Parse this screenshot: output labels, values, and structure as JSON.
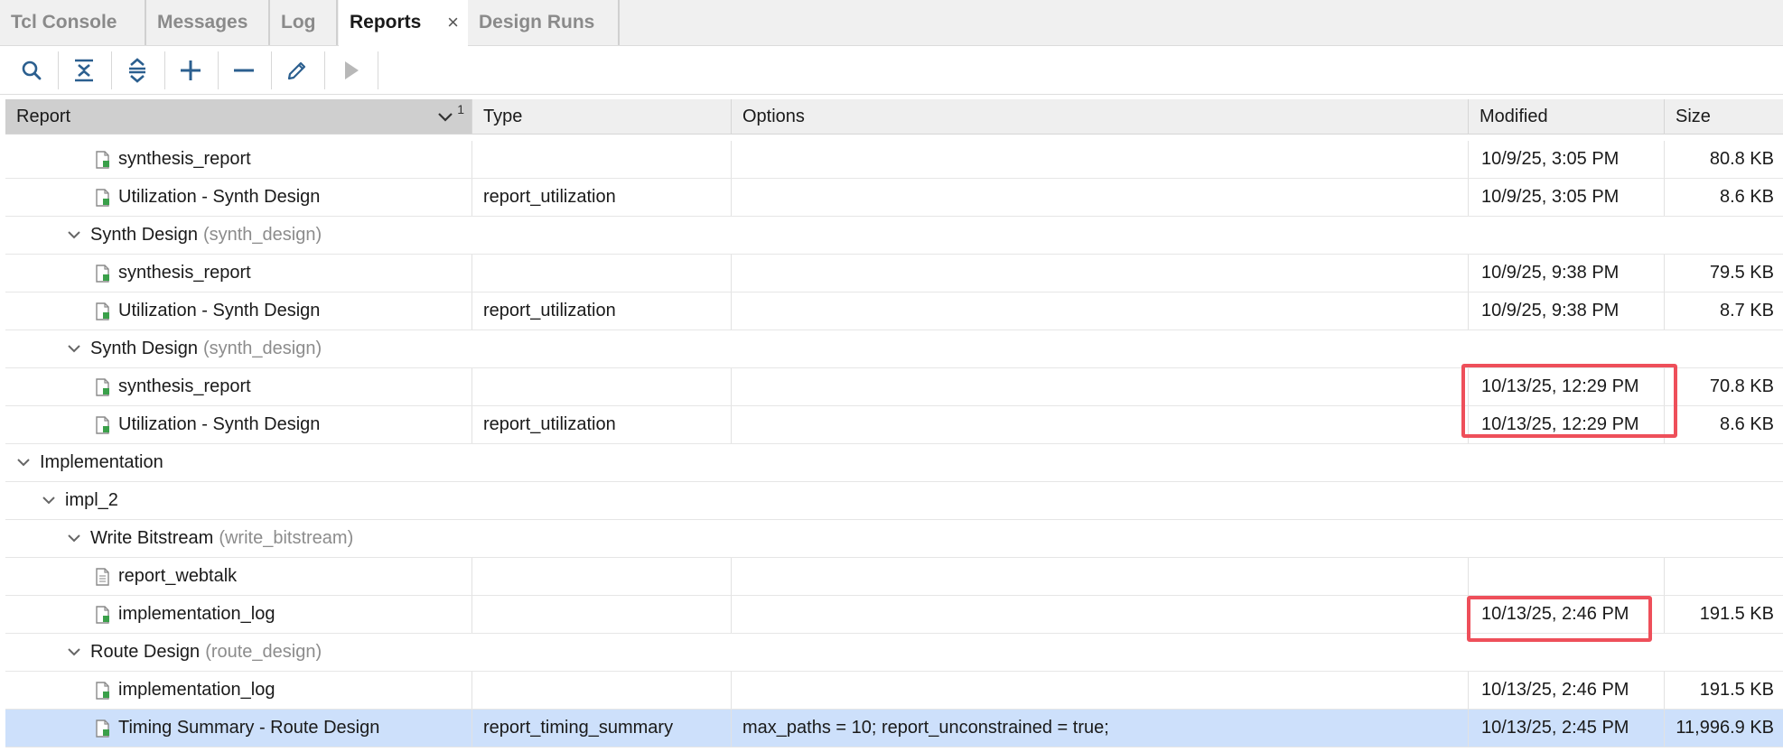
{
  "tabs": [
    {
      "label": "Tcl Console",
      "active": false
    },
    {
      "label": "Messages",
      "active": false
    },
    {
      "label": "Log",
      "active": false
    },
    {
      "label": "Reports",
      "active": true
    },
    {
      "label": "Design Runs",
      "active": false
    }
  ],
  "tab_close_glyph": "×",
  "toolbar": [
    {
      "name": "search-icon"
    },
    {
      "name": "collapse-all-icon"
    },
    {
      "name": "expand-all-icon"
    },
    {
      "name": "add-icon"
    },
    {
      "name": "remove-icon"
    },
    {
      "name": "edit-icon"
    },
    {
      "name": "run-icon"
    }
  ],
  "columns": {
    "report": "Report",
    "sort_index": "1",
    "type": "Type",
    "options": "Options",
    "modified": "Modified",
    "size": "Size"
  },
  "rows": [
    {
      "level": 3,
      "kind": "file",
      "name": "synthesis_report",
      "type": "",
      "options": "",
      "modified": "10/9/25, 3:05 PM",
      "size": "80.8 KB"
    },
    {
      "level": 3,
      "kind": "file",
      "name": "Utilization - Synth Design",
      "type": "report_utilization",
      "options": "",
      "modified": "10/9/25, 3:05 PM",
      "size": "8.6 KB"
    },
    {
      "level": 2,
      "kind": "group",
      "name": "Synth Design",
      "sub": "(synth_design)"
    },
    {
      "level": 3,
      "kind": "file",
      "name": "synthesis_report",
      "type": "",
      "options": "",
      "modified": "10/9/25, 9:38 PM",
      "size": "79.5 KB"
    },
    {
      "level": 3,
      "kind": "file",
      "name": "Utilization - Synth Design",
      "type": "report_utilization",
      "options": "",
      "modified": "10/9/25, 9:38 PM",
      "size": "8.7 KB"
    },
    {
      "level": 2,
      "kind": "group",
      "name": "Synth Design",
      "sub": "(synth_design)"
    },
    {
      "level": 3,
      "kind": "file",
      "name": "synthesis_report",
      "type": "",
      "options": "",
      "modified": "10/13/25, 12:29 PM",
      "size": "70.8 KB"
    },
    {
      "level": 3,
      "kind": "file",
      "name": "Utilization - Synth Design",
      "type": "report_utilization",
      "options": "",
      "modified": "10/13/25, 12:29 PM",
      "size": "8.6 KB"
    },
    {
      "level": 0,
      "kind": "group",
      "name": "Implementation",
      "sub": ""
    },
    {
      "level": 1,
      "kind": "group",
      "name": "impl_2",
      "sub": ""
    },
    {
      "level": 2,
      "kind": "group",
      "name": "Write Bitstream",
      "sub": "(write_bitstream)"
    },
    {
      "level": 3,
      "kind": "file-empty",
      "name": "report_webtalk",
      "type": "",
      "options": "",
      "modified": "",
      "size": ""
    },
    {
      "level": 3,
      "kind": "file",
      "name": "implementation_log",
      "type": "",
      "options": "",
      "modified": "10/13/25, 2:46 PM",
      "size": "191.5 KB"
    },
    {
      "level": 2,
      "kind": "group",
      "name": "Route Design",
      "sub": "(route_design)"
    },
    {
      "level": 3,
      "kind": "file",
      "name": "implementation_log",
      "type": "",
      "options": "",
      "modified": "10/13/25, 2:46 PM",
      "size": "191.5 KB"
    },
    {
      "level": 3,
      "kind": "file",
      "name": "Timing Summary - Route Design",
      "type": "report_timing_summary",
      "options": "max_paths = 10; report_unconstrained = true;",
      "modified": "10/13/25, 2:45 PM",
      "size": "11,996.9 KB",
      "selected": true
    }
  ],
  "colors": {
    "highlight": "#ee4f5a",
    "selection": "#cde0fb",
    "file_icon_green": "#3aa04a"
  }
}
